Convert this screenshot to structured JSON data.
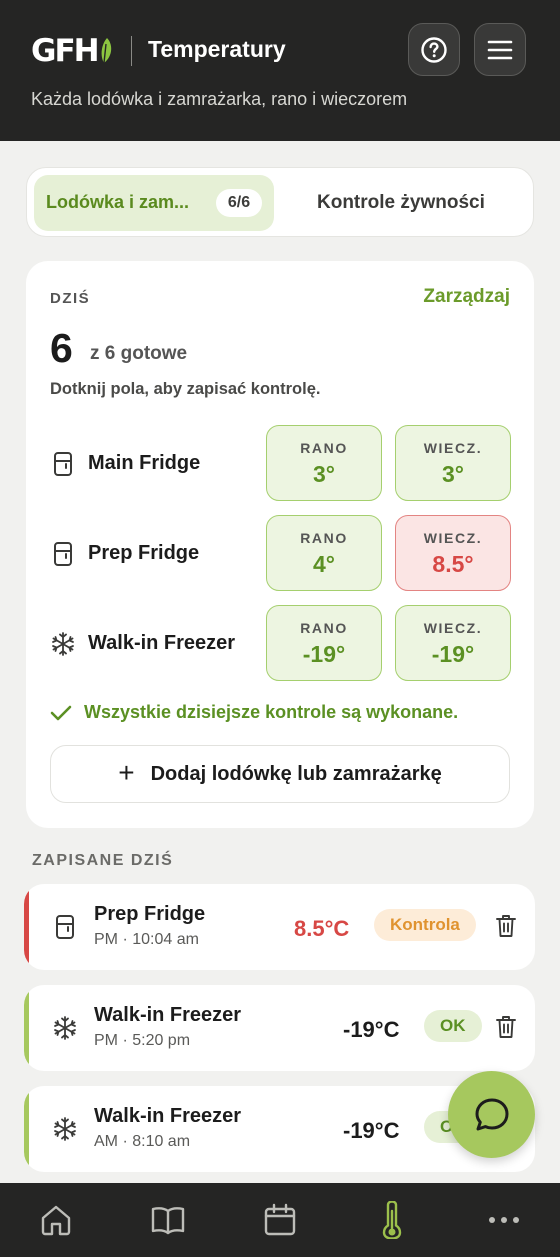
{
  "header": {
    "logo_text": "GFH",
    "title": "Temperatury",
    "subtitle": "Każda lodówka i zamrażarka, rano i wieczorem",
    "help_icon": "help-circle-icon",
    "menu_icon": "hamburger-menu-icon"
  },
  "tabs": {
    "active_label": "Lodówka i zam...",
    "active_badge": "6/6",
    "other_label": "Kontrole żywności"
  },
  "today": {
    "label": "DZIŚ",
    "manage_link": "Zarządzaj",
    "count_done": "6",
    "count_rest": "z 6 gotowe",
    "hint": "Dotknij pola, aby zapisać kontrolę.",
    "units": [
      {
        "name": "Main Fridge",
        "icon": "fridge-icon",
        "am_label": "RANO",
        "am_value": "3°",
        "pm_label": "WIECZ.",
        "pm_value": "3°",
        "pm_alert": false
      },
      {
        "name": "Prep Fridge",
        "icon": "fridge-icon",
        "am_label": "RANO",
        "am_value": "4°",
        "pm_label": "WIECZ.",
        "pm_value": "8.5°",
        "pm_alert": true
      },
      {
        "name": "Walk-in Freezer",
        "icon": "snowflake-icon",
        "am_label": "RANO",
        "am_value": "-19°",
        "pm_label": "WIECZ.",
        "pm_value": "-19°",
        "pm_alert": false
      }
    ],
    "done_message": "Wszystkie dzisiejsze kontrole są wykonane.",
    "add_button": "Dodaj lodówkę lub zamrażarkę"
  },
  "saved": {
    "label": "ZAPISANE DZIŚ",
    "logs": [
      {
        "name": "Prep Fridge",
        "meta": "PM · 10:04 am",
        "temp": "8.5°C",
        "status": "Kontrola",
        "icon": "fridge-icon"
      },
      {
        "name": "Walk-in Freezer",
        "meta": "PM · 5:20 pm",
        "temp": "-19°C",
        "status": "OK",
        "icon": "snowflake-icon"
      },
      {
        "name": "Walk-in Freezer",
        "meta": "AM · 8:10 am",
        "temp": "-19°C",
        "status": "OK",
        "icon": "snowflake-icon"
      }
    ]
  },
  "fab_icon": "chat-bubble-icon",
  "bottom_nav": [
    {
      "name": "home",
      "icon": "home-icon"
    },
    {
      "name": "book",
      "icon": "book-icon"
    },
    {
      "name": "calendar",
      "icon": "calendar-icon"
    },
    {
      "name": "temperatures",
      "icon": "thermometer-icon",
      "active": true
    },
    {
      "name": "more",
      "icon": "more-dots-icon"
    }
  ],
  "colors": {
    "brand_green": "#6b9b2b",
    "alert_red": "#d74845",
    "warning_orange": "#e0932f",
    "header_bg": "#252524"
  }
}
